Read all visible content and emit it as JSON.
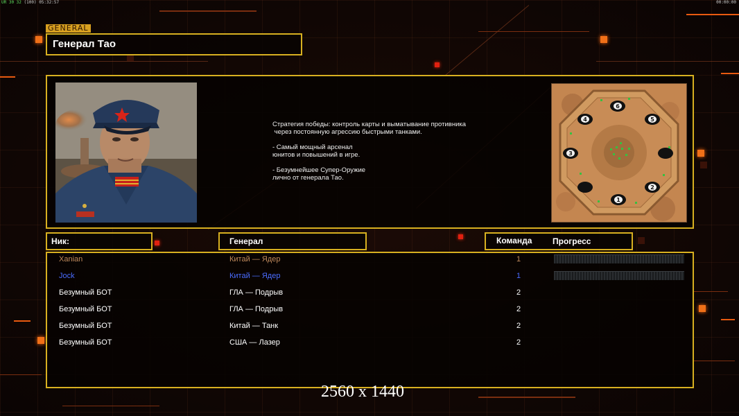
{
  "topbar": {
    "left_green": "UR 30 32",
    "left_text": " (100) 05:32:57",
    "right_text": "00:00:00"
  },
  "general_tag": "GENERAL",
  "title": "Генерал Тао",
  "description": [
    "Стратегия победы: контроль карты и выматывание противника",
    " через постоянную агрессию быстрыми танками.",
    "",
    "- Самый мощный арсенал",
    "юнитов и повышений в игре.",
    "",
    "- Безумнейшее Супер-Оружие",
    "лично от генерала Тао."
  ],
  "map": {
    "start_positions": [
      "1",
      "2",
      "3",
      "4",
      "5",
      "6"
    ]
  },
  "columns": {
    "nick": "Ник:",
    "general": "Генерал",
    "team": "Команда",
    "progress": "Прогресс"
  },
  "players": [
    {
      "nick": "Xanian",
      "general": "Китай — Ядер",
      "team": "1",
      "color": "#c08a5c",
      "progress": true
    },
    {
      "nick": "Jock",
      "general": "Китай — Ядер",
      "team": "1",
      "color": "#4a6cff",
      "progress": true
    },
    {
      "nick": "Безумный БОТ",
      "general": "ГЛА — Подрыв",
      "team": "2",
      "color": "#ffffff",
      "progress": false
    },
    {
      "nick": "Безумный БОТ",
      "general": "ГЛА — Подрыв",
      "team": "2",
      "color": "#ffffff",
      "progress": false
    },
    {
      "nick": "Безумный БОТ",
      "general": "Китай — Танк",
      "team": "2",
      "color": "#ffffff",
      "progress": false
    },
    {
      "nick": "Безумный БОТ",
      "general": "США — Лазер",
      "team": "2",
      "color": "#ffffff",
      "progress": false
    }
  ],
  "resolution_label": "2560 x 1440",
  "colors": {
    "frame": "#d8b020",
    "accent": "#f07018"
  }
}
